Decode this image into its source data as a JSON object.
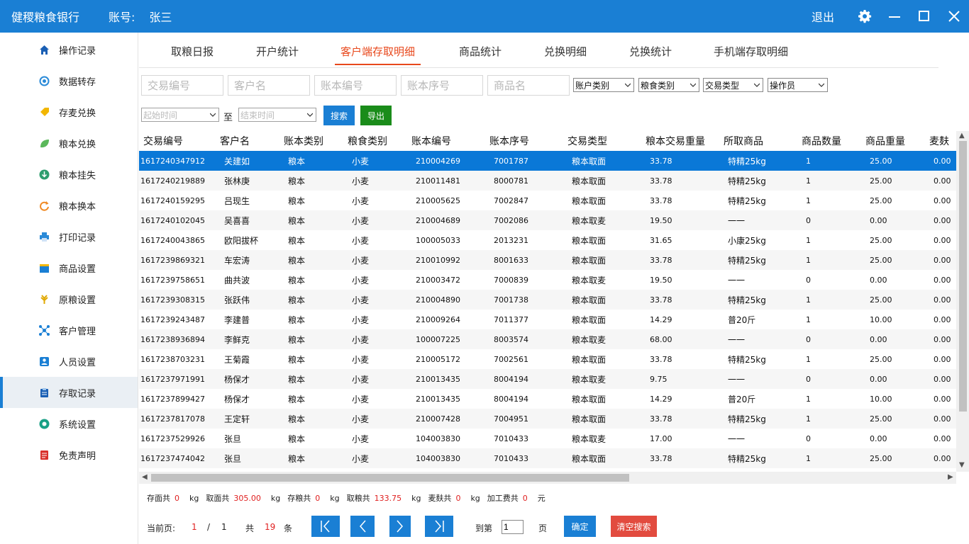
{
  "titlebar": {
    "app_name": "健稷粮食银行",
    "account_label": "账号:",
    "account_user": "张三",
    "logout": "退出"
  },
  "sidebar": {
    "items": [
      {
        "label": "操作记录",
        "icon": "home-icon",
        "color": "#1a5fb4"
      },
      {
        "label": "数据转存",
        "icon": "transfer-icon",
        "color": "#2a8ad8"
      },
      {
        "label": "存麦兑换",
        "icon": "tag-icon",
        "color": "#f2b600"
      },
      {
        "label": "粮本兑换",
        "icon": "leaf-icon",
        "color": "#5bb85b"
      },
      {
        "label": "粮本挂失",
        "icon": "download-icon",
        "color": "#2e9e6e"
      },
      {
        "label": "粮本换本",
        "icon": "refresh-icon",
        "color": "#f08a24"
      },
      {
        "label": "打印记录",
        "icon": "printer-icon",
        "color": "#2a8ad8"
      },
      {
        "label": "商品设置",
        "icon": "box-icon",
        "color": "#1a7fd4"
      },
      {
        "label": "原粮设置",
        "icon": "wheat-icon",
        "color": "#e0a800"
      },
      {
        "label": "客户管理",
        "icon": "network-icon",
        "color": "#1a7fd4"
      },
      {
        "label": "人员设置",
        "icon": "person-icon",
        "color": "#1a7fd4"
      },
      {
        "label": "存取记录",
        "icon": "clipboard-icon",
        "color": "#1a5fb4"
      },
      {
        "label": "系统设置",
        "icon": "settings-icon",
        "color": "#19a086"
      },
      {
        "label": "免责声明",
        "icon": "document-icon",
        "color": "#d9302b"
      }
    ],
    "active_index": 11
  },
  "tabs": [
    {
      "label": "取粮日报"
    },
    {
      "label": "开户统计"
    },
    {
      "label": "客户端存取明细",
      "active": true
    },
    {
      "label": "商品统计"
    },
    {
      "label": "兑换明细"
    },
    {
      "label": "兑换统计"
    },
    {
      "label": "手机端存取明细"
    }
  ],
  "filters": {
    "txn_no_placeholder": "交易编号",
    "customer_placeholder": "客户名",
    "book_no_placeholder": "账本编号",
    "book_seq_placeholder": "账本序号",
    "goods_placeholder": "商品名",
    "account_type": "账户类别",
    "grain_type": "粮食类别",
    "txn_type": "交易类型",
    "operator": "操作员",
    "start_time": "起始时间",
    "to_label": "至",
    "end_time": "结束时间",
    "search_btn": "搜索",
    "export_btn": "导出"
  },
  "table": {
    "columns": [
      "交易编号",
      "客户名",
      "账本类别",
      "粮食类别",
      "账本编号",
      "账本序号",
      "交易类型",
      "粮本交易重量",
      "所取商品",
      "商品数量",
      "商品重量",
      "麦麸"
    ],
    "selected_row": 0,
    "rows": [
      [
        "1617240347912",
        "关建如",
        "粮本",
        "小麦",
        "210004269",
        "7001787",
        "粮本取面",
        "33.78",
        "特精25kg",
        "1",
        "25.00",
        "0.00"
      ],
      [
        "1617240219889",
        "张林庚",
        "粮本",
        "小麦",
        "210011481",
        "8000781",
        "粮本取面",
        "33.78",
        "特精25kg",
        "1",
        "25.00",
        "0.00"
      ],
      [
        "1617240159295",
        "吕现生",
        "粮本",
        "小麦",
        "210005625",
        "7002847",
        "粮本取面",
        "33.78",
        "特精25kg",
        "1",
        "25.00",
        "0.00"
      ],
      [
        "1617240102045",
        "吴喜喜",
        "粮本",
        "小麦",
        "210004689",
        "7002086",
        "粮本取麦",
        "19.50",
        "一一",
        "0",
        "0.00",
        "0.00"
      ],
      [
        "1617240043865",
        "欧阳拔杯",
        "粮本",
        "小麦",
        "100005033",
        "2013231",
        "粮本取面",
        "31.65",
        "小康25kg",
        "1",
        "25.00",
        "0.00"
      ],
      [
        "1617239869321",
        "车宏涛",
        "粮本",
        "小麦",
        "210010992",
        "8001633",
        "粮本取面",
        "33.78",
        "特精25kg",
        "1",
        "25.00",
        "0.00"
      ],
      [
        "1617239758651",
        "曲共波",
        "粮本",
        "小麦",
        "210003472",
        "7000839",
        "粮本取麦",
        "19.50",
        "一一",
        "0",
        "0.00",
        "0.00"
      ],
      [
        "1617239308315",
        "张跃伟",
        "粮本",
        "小麦",
        "210004890",
        "7001738",
        "粮本取面",
        "33.78",
        "特精25kg",
        "1",
        "25.00",
        "0.00"
      ],
      [
        "1617239243487",
        "李建普",
        "粮本",
        "小麦",
        "210009264",
        "7011377",
        "粮本取面",
        "14.29",
        "普20斤",
        "1",
        "10.00",
        "0.00"
      ],
      [
        "1617238936894",
        "李鲜克",
        "粮本",
        "小麦",
        "100007225",
        "8003574",
        "粮本取麦",
        "68.00",
        "一一",
        "0",
        "0.00",
        "0.00"
      ],
      [
        "1617238703231",
        "王菊霞",
        "粮本",
        "小麦",
        "210005172",
        "7002561",
        "粮本取面",
        "33.78",
        "特精25kg",
        "1",
        "25.00",
        "0.00"
      ],
      [
        "1617237971991",
        "杨保才",
        "粮本",
        "小麦",
        "210013435",
        "8004194",
        "粮本取麦",
        "9.75",
        "一一",
        "0",
        "0.00",
        "0.00"
      ],
      [
        "1617237899427",
        "杨保才",
        "粮本",
        "小麦",
        "210013435",
        "8004194",
        "粮本取面",
        "14.29",
        "普20斤",
        "1",
        "10.00",
        "0.00"
      ],
      [
        "1617237817078",
        "王定轩",
        "粮本",
        "小麦",
        "210007428",
        "7004951",
        "粮本取面",
        "33.78",
        "特精25kg",
        "1",
        "25.00",
        "0.00"
      ],
      [
        "1617237529926",
        "张旦",
        "粮本",
        "小麦",
        "104003830",
        "7010433",
        "粮本取麦",
        "17.00",
        "一一",
        "0",
        "0.00",
        "0.00"
      ],
      [
        "1617237474042",
        "张旦",
        "粮本",
        "小麦",
        "104003830",
        "7010433",
        "粮本取面",
        "33.78",
        "特精25kg",
        "1",
        "25.00",
        "0.00"
      ]
    ]
  },
  "summary": [
    {
      "label": "存面共",
      "value": "0",
      "unit": "kg"
    },
    {
      "label": "取面共",
      "value": "305.00",
      "unit": "kg"
    },
    {
      "label": "存粮共",
      "value": "0",
      "unit": "kg"
    },
    {
      "label": "取粮共",
      "value": "133.75",
      "unit": "kg"
    },
    {
      "label": "麦麸共",
      "value": "0",
      "unit": "kg"
    },
    {
      "label": "加工费共",
      "value": "0",
      "unit": "元"
    }
  ],
  "pager": {
    "current_label": "当前页:",
    "current": "1",
    "sep": "/",
    "total_pages": "1",
    "total_label": "共",
    "total_count": "19",
    "count_unit": "条",
    "goto_label": "到第",
    "goto_value": "1",
    "page_unit": "页",
    "confirm_btn": "确定",
    "clear_btn": "清空搜索"
  },
  "colors": {
    "brand": "#1a7fd4",
    "active_tab": "#e8481c",
    "selected_row": "#0a78d7",
    "export": "#1a8c1a",
    "clear": "#e24b3f",
    "value_red": "#e02020"
  }
}
